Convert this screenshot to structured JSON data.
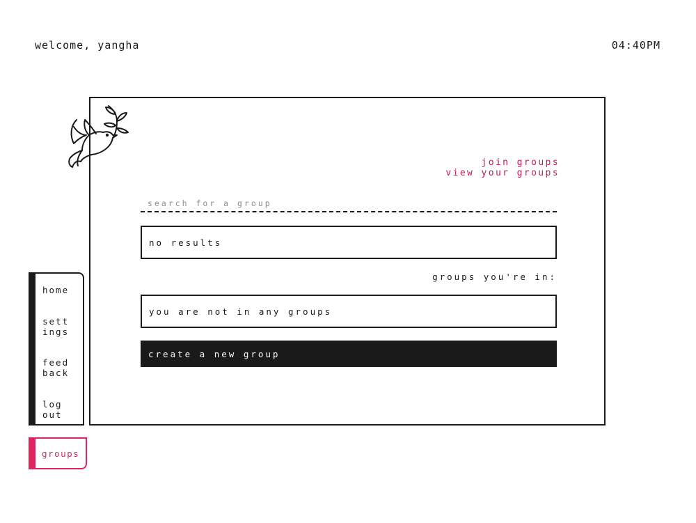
{
  "header": {
    "welcome_text": "welcome, yangha",
    "time": "04:40PM"
  },
  "logo": {
    "icon": "dove-with-olive-branch-icon"
  },
  "links": {
    "join_groups": "join groups",
    "view_your_groups": "view your groups"
  },
  "search": {
    "placeholder": "search for a group",
    "value": ""
  },
  "results": {
    "text": "no results"
  },
  "my_groups": {
    "heading": "groups you're in:",
    "empty_text": "you are not in any groups"
  },
  "actions": {
    "create_label": "create a new group"
  },
  "sidebar": {
    "home": "home",
    "settings": "sett\nings",
    "feedback": "feed\nback",
    "logout": "log\nout",
    "active_tab": "groups"
  },
  "colors": {
    "accent": "#c8184a",
    "active_tab": "#e0245e",
    "ink": "#1a1a1a",
    "background": "#ffffff"
  }
}
